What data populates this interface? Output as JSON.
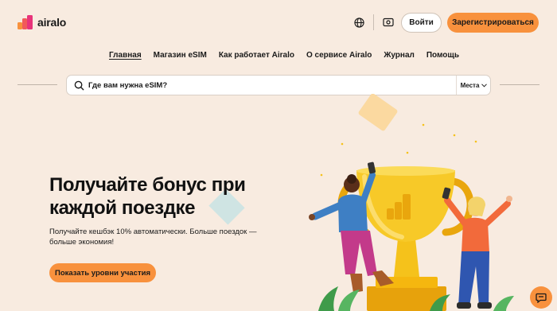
{
  "header": {
    "logo_text": "airalo",
    "globe_icon": "globe-icon",
    "currency_icon": "currency-icon",
    "login_label": "Войти",
    "register_label": "Зарегистрироваться"
  },
  "nav": {
    "items": [
      {
        "label": "Главная",
        "active": true
      },
      {
        "label": "Магазин eSIM",
        "active": false
      },
      {
        "label": "Как работает Airalo",
        "active": false
      },
      {
        "label": "О сервисе Airalo",
        "active": false
      },
      {
        "label": "Журнал",
        "active": false
      },
      {
        "label": "Помощь",
        "active": false
      }
    ]
  },
  "search": {
    "placeholder": "Где вам нужна eSIM?",
    "dropdown_label": "Места"
  },
  "hero": {
    "title": "Получайте бонус при каждой поездке",
    "subtitle": "Получайте кешбэк 10% автоматически. Больше поездок — больше экономия!",
    "cta_label": "Показать уровни участия"
  },
  "colors": {
    "background": "#f8ebe0",
    "accent": "#f8913d",
    "trophy": "#f5c21b"
  }
}
